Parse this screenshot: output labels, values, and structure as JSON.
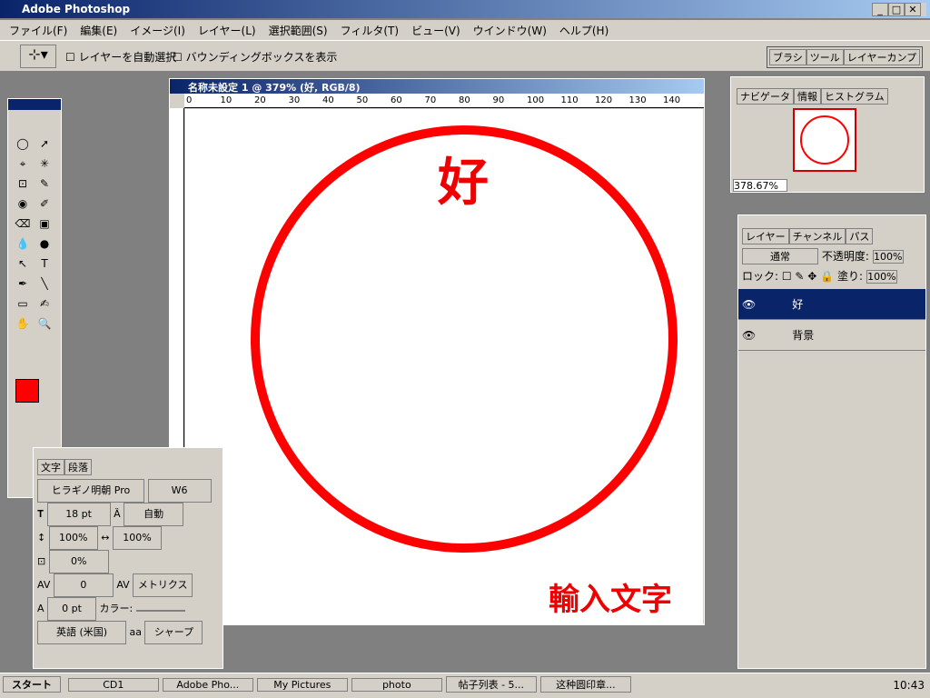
{
  "app": {
    "title": "Adobe Photoshop"
  },
  "menu": [
    "ファイル(F)",
    "編集(E)",
    "イメージ(I)",
    "レイヤー(L)",
    "選択範囲(S)",
    "フィルタ(T)",
    "ビュー(V)",
    "ウインドウ(W)",
    "ヘルプ(H)"
  ],
  "options": {
    "autoselect": "レイヤーを自動選択",
    "bbox": "バウンディングボックスを表示",
    "tabs": [
      "ブラシ",
      "ツール",
      "レイヤーカンプ"
    ]
  },
  "doc": {
    "title": "名称未設定 1 @ 379% (好, RGB/8)",
    "glyph": "好",
    "caption": "輸入文字",
    "ruler": [
      "0",
      "10",
      "20",
      "30",
      "40",
      "50",
      "60",
      "70",
      "80",
      "90",
      "100",
      "110",
      "120",
      "130",
      "140"
    ]
  },
  "nav": {
    "tabs": [
      "ナビゲータ",
      "情報",
      "ヒストグラム"
    ],
    "zoom": "378.67%"
  },
  "layers": {
    "tabs": [
      "レイヤー",
      "チャンネル",
      "パス"
    ],
    "blend": "通常",
    "opacity_label": "不透明度:",
    "opacity": "100%",
    "lock": "ロック:",
    "fill_label": "塗り:",
    "fill": "100%",
    "rows": [
      {
        "name": "好"
      },
      {
        "name": "背景"
      }
    ]
  },
  "char": {
    "tabs": [
      "文字",
      "段落"
    ],
    "font": "ヒラギノ明朝 Pro",
    "weight": "W6",
    "size": "18 pt",
    "leading": "自動",
    "vscale": "100%",
    "hscale": "100%",
    "tracking_pct": "0%",
    "kern": "0",
    "metrics": "メトリクス",
    "baseline": "0 pt",
    "color_label": "カラー:",
    "lang": "英語 (米国)",
    "aa_label": "aa",
    "aa": "シャープ"
  },
  "taskbar": {
    "start": "スタート",
    "items": [
      "CD1",
      "Adobe Pho...",
      "My Pictures",
      "photo",
      "帖子列表 - 5...",
      "这种圆印章..."
    ],
    "clock": "10:43"
  }
}
